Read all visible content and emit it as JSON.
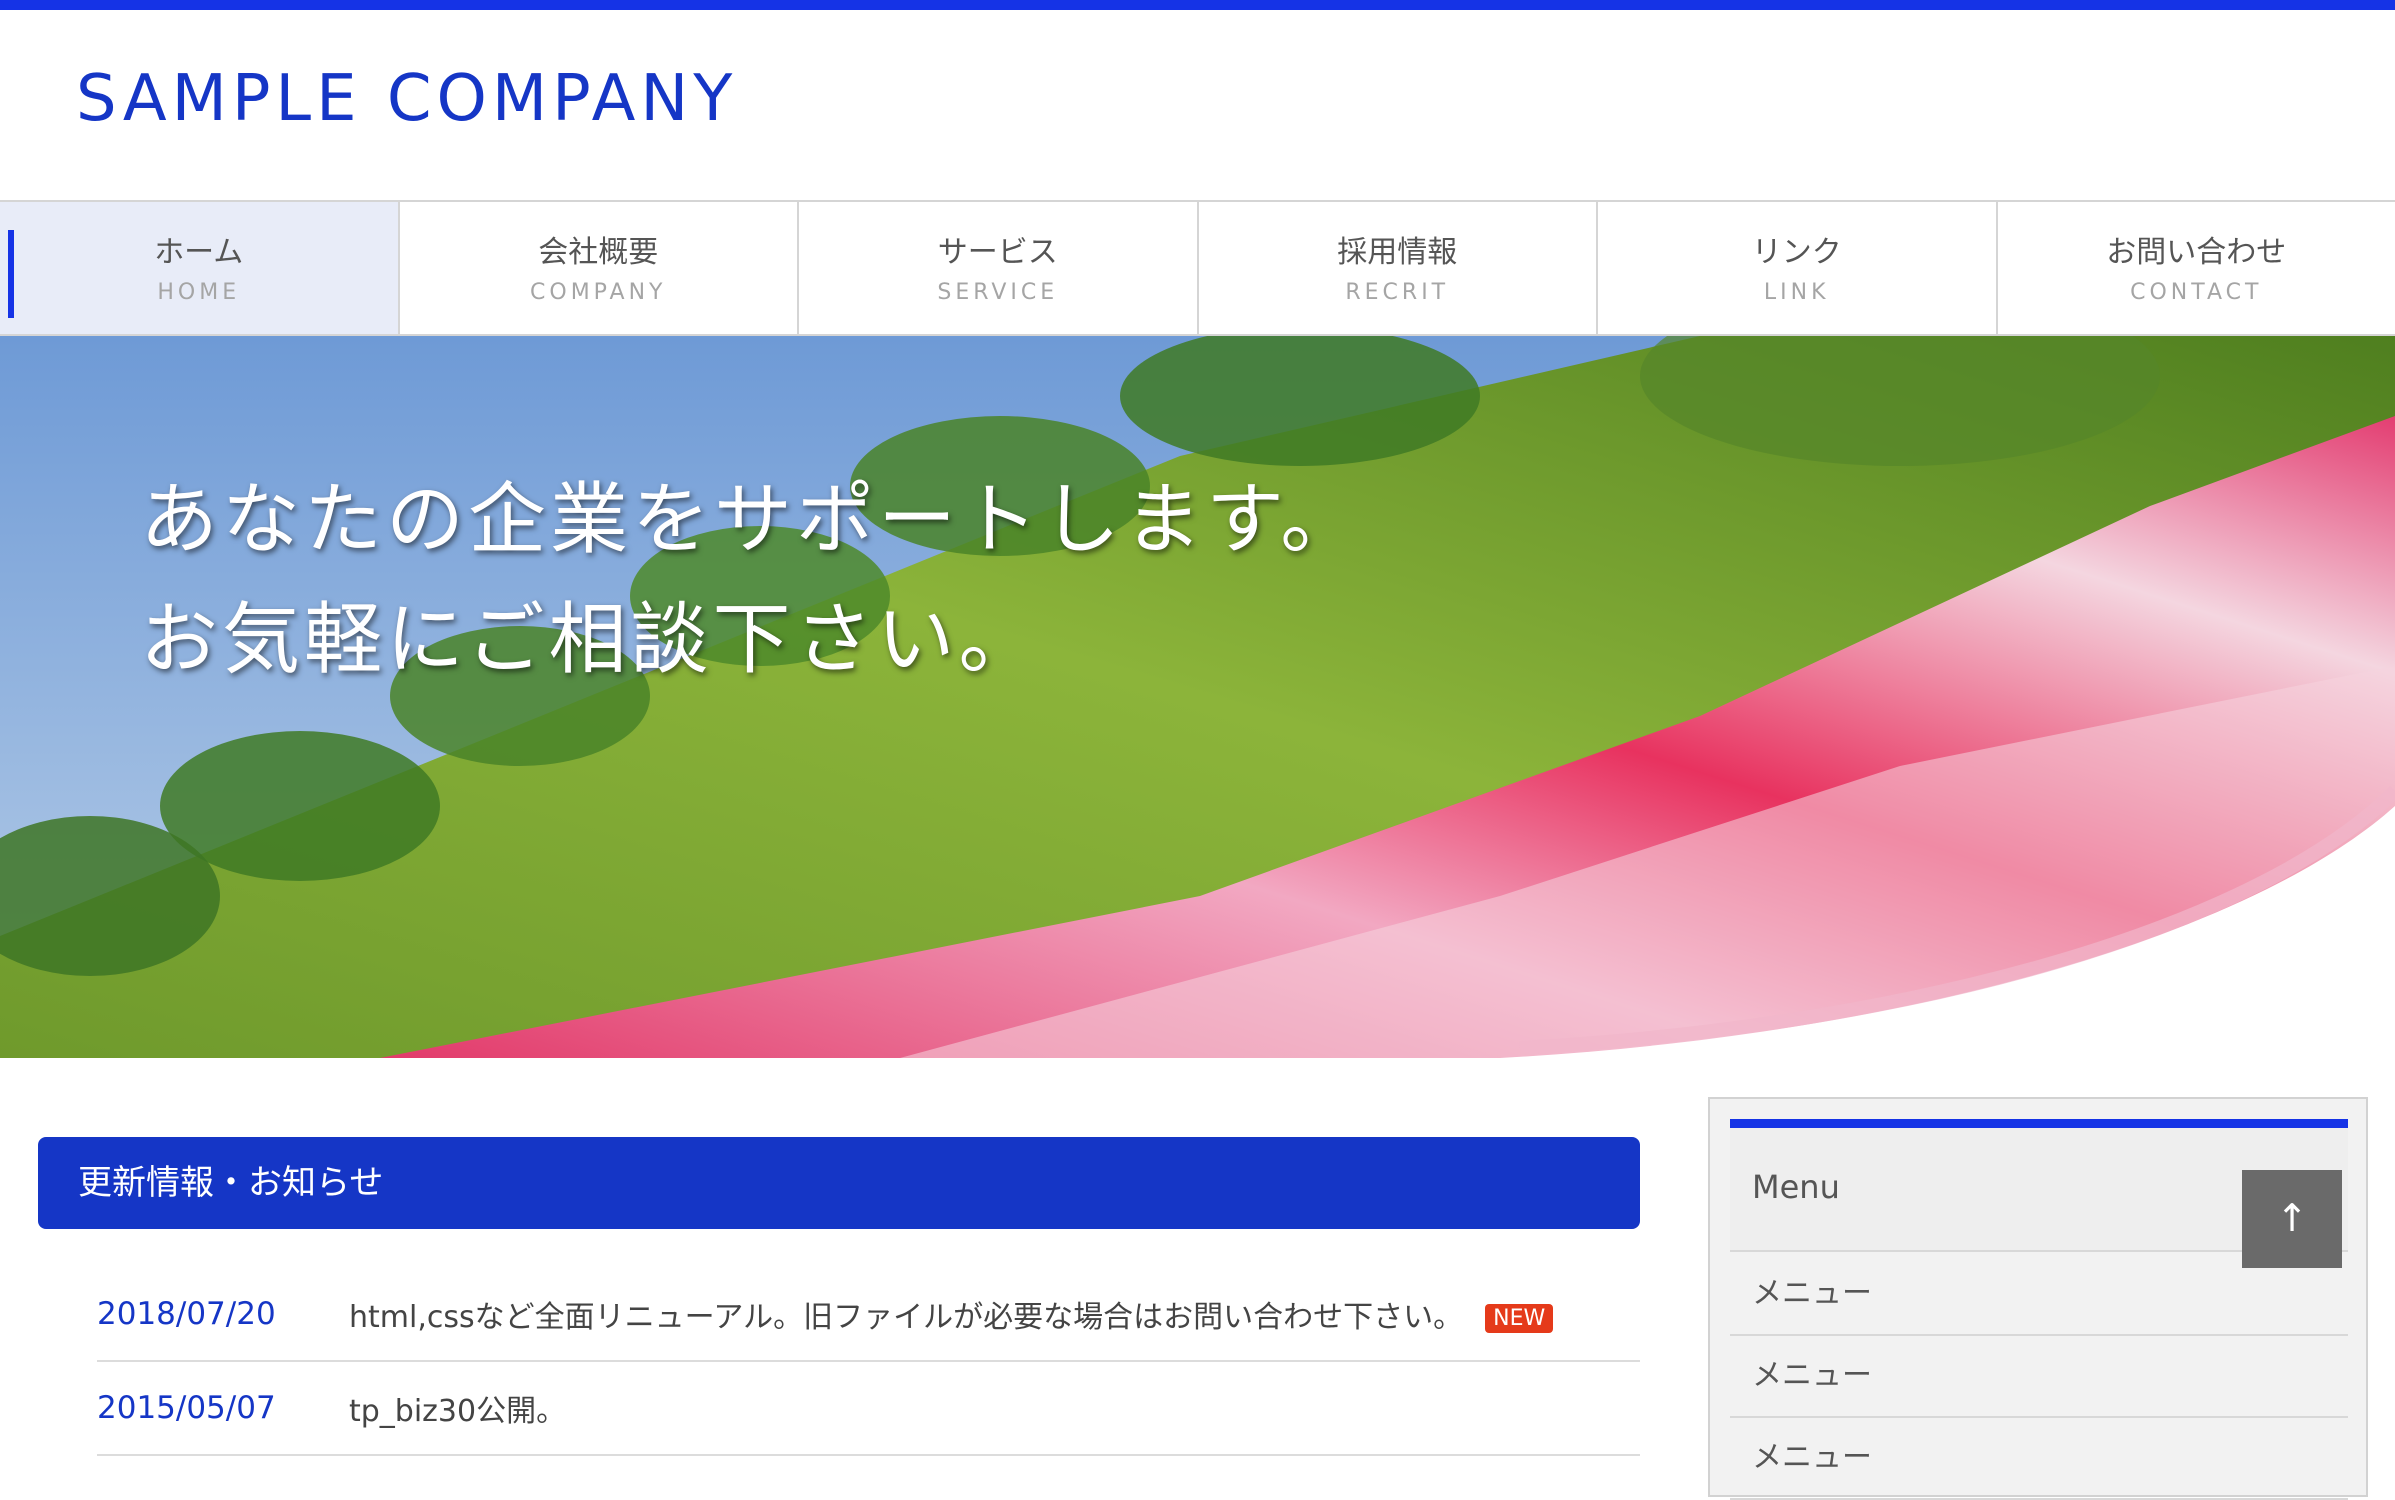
{
  "site": {
    "logo": "SAMPLE COMPANY",
    "accent_color": "#1533e6",
    "brand_color": "#1536c6"
  },
  "nav": {
    "items": [
      {
        "ja": "ホーム",
        "en": "HOME",
        "active": true
      },
      {
        "ja": "会社概要",
        "en": "COMPANY"
      },
      {
        "ja": "サービス",
        "en": "SERVICE"
      },
      {
        "ja": "採用情報",
        "en": "RECRIT"
      },
      {
        "ja": "リンク",
        "en": "LINK"
      },
      {
        "ja": "お問い合わせ",
        "en": "CONTACT"
      }
    ]
  },
  "hero": {
    "line1": "あなたの企業をサポートします。",
    "line2": "お気軽にご相談下さい。"
  },
  "news": {
    "heading": "更新情報・お知らせ",
    "items": [
      {
        "date": "2018/07/20",
        "text": "html,cssなど全面リニューアル。旧ファイルが必要な場合はお問い合わせ下さい。",
        "badge": "NEW"
      },
      {
        "date": "2015/05/07",
        "text": "tp_biz30公開。"
      }
    ]
  },
  "sidebar": {
    "heading": "Menu",
    "items": [
      "メニュー",
      "メニュー",
      "メニュー"
    ]
  },
  "to_top": {
    "icon": "arrow-up-icon",
    "glyph": "↑"
  }
}
